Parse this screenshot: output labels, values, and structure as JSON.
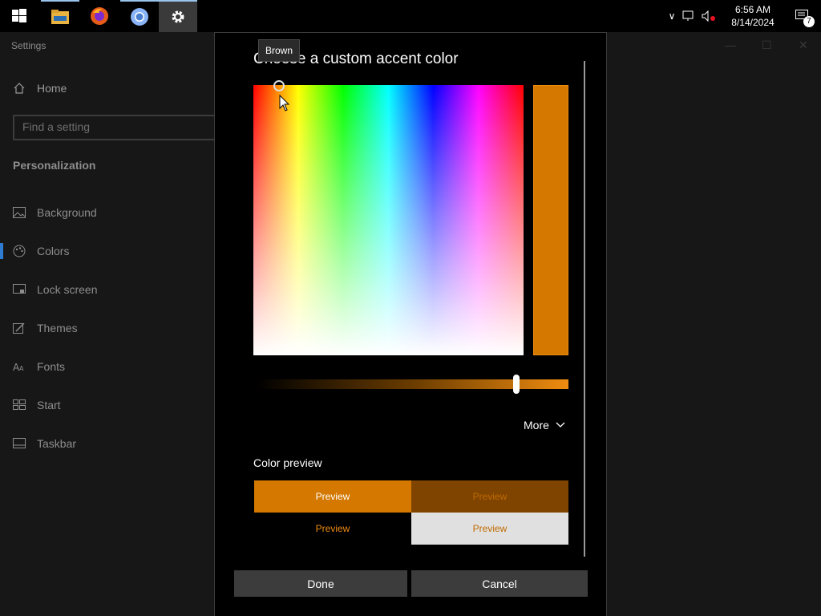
{
  "taskbar": {
    "apps": [
      "Start",
      "File Explorer",
      "Firefox",
      "Chrome",
      "Settings"
    ],
    "time": "6:56 AM",
    "date": "8/14/2024",
    "notification_count": "7"
  },
  "settings": {
    "window_title": "Settings",
    "home_label": "Home",
    "search_placeholder": "Find a setting",
    "section_title": "Personalization",
    "nav_items": [
      {
        "label": "Background",
        "icon": "picture-icon"
      },
      {
        "label": "Colors",
        "icon": "palette-icon",
        "selected": true
      },
      {
        "label": "Lock screen",
        "icon": "lock-screen-icon"
      },
      {
        "label": "Themes",
        "icon": "brush-icon"
      },
      {
        "label": "Fonts",
        "icon": "font-icon"
      },
      {
        "label": "Start",
        "icon": "start-icon"
      },
      {
        "label": "Taskbar",
        "icon": "taskbar-icon"
      }
    ]
  },
  "dialog": {
    "title": "Choose a custom accent color",
    "tooltip": "Brown",
    "selected_color": "#d47800",
    "more_label": "More",
    "preview_label": "Color preview",
    "preview_text": "Preview",
    "done_label": "Done",
    "cancel_label": "Cancel"
  },
  "colors": {
    "accent": "#d47800",
    "accent_dark": "#7e4400",
    "accent_text": "#f08c10"
  }
}
